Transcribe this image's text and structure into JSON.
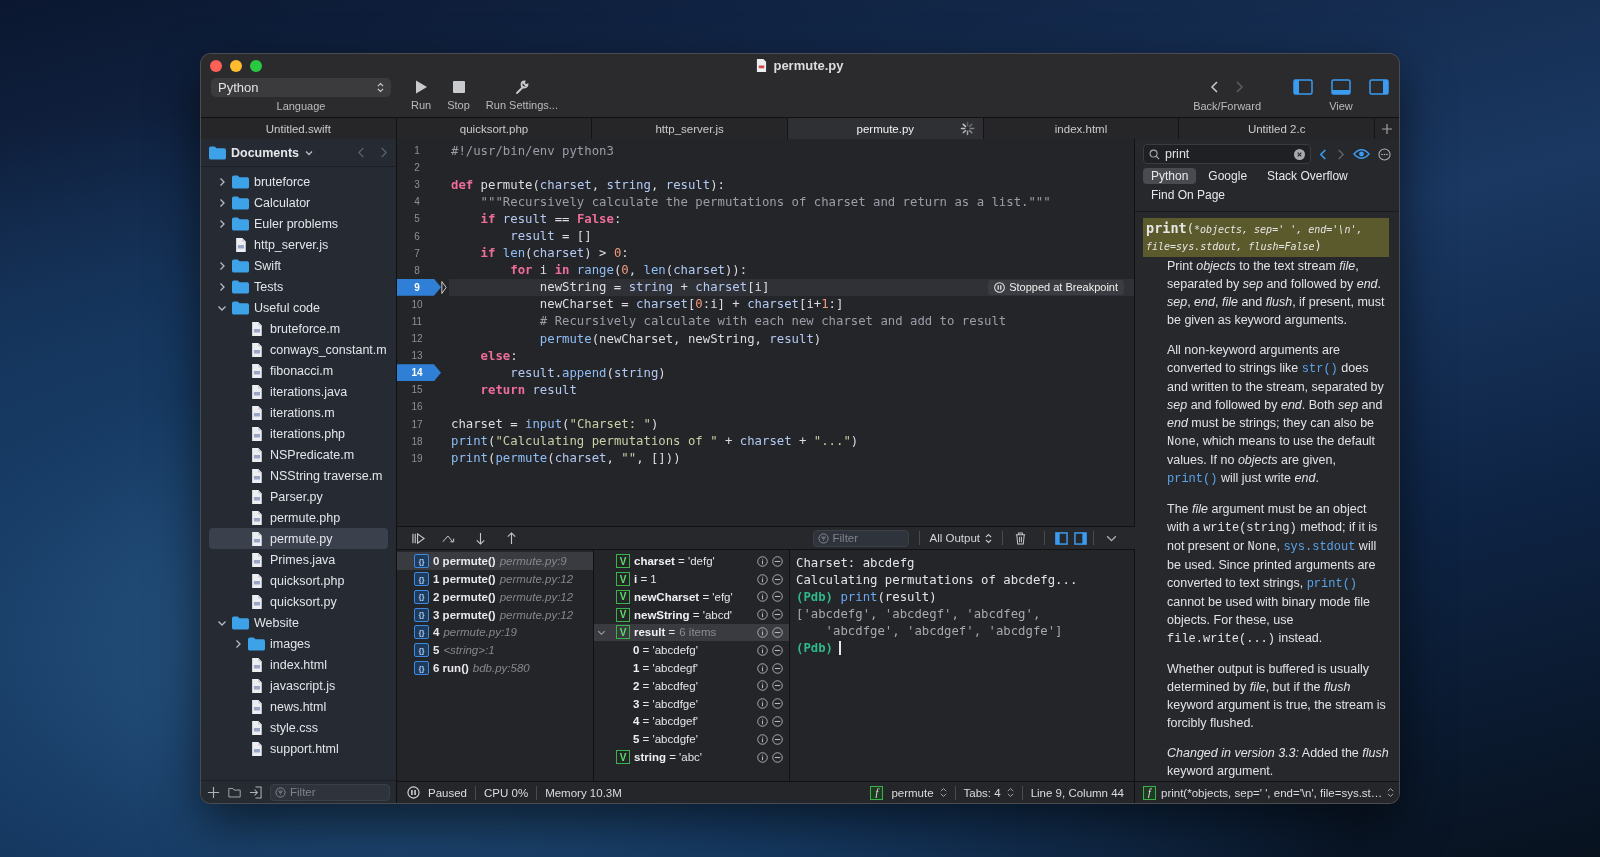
{
  "window": {
    "title": "permute.py"
  },
  "toolbar": {
    "language": {
      "value": "Python",
      "label": "Language"
    },
    "actions": [
      {
        "kind": "run",
        "label": "Run"
      },
      {
        "kind": "stop",
        "label": "Stop"
      },
      {
        "kind": "settings",
        "label": "Run Settings..."
      }
    ],
    "navigation": {
      "label": "Back/Forward",
      "back_enabled": true,
      "forward_enabled": false
    },
    "view": {
      "label": "View",
      "panels": [
        {
          "kind": "left",
          "on": true
        },
        {
          "kind": "bottom",
          "on": true
        },
        {
          "kind": "right",
          "on": true
        }
      ]
    }
  },
  "tabs": [
    {
      "label": "Untitled.swift",
      "selected": false,
      "busy": false
    },
    {
      "label": "quicksort.php",
      "selected": false,
      "busy": false
    },
    {
      "label": "http_server.js",
      "selected": false,
      "busy": false
    },
    {
      "label": "permute.py",
      "selected": true,
      "busy": true
    },
    {
      "label": "index.html",
      "selected": false,
      "busy": false
    },
    {
      "label": "Untitled 2.c",
      "selected": false,
      "busy": false
    }
  ],
  "sidebar": {
    "location": "Documents",
    "filter_placeholder": "Filter",
    "tools": [
      {
        "kind": "add"
      },
      {
        "kind": "folder"
      },
      {
        "kind": "import"
      }
    ],
    "items": [
      {
        "label": "bruteforce",
        "kind": "folder",
        "expanded": false,
        "selected": false
      },
      {
        "label": "Calculator",
        "kind": "folder",
        "expanded": false,
        "selected": false
      },
      {
        "label": "Euler problems",
        "kind": "folder",
        "expanded": false,
        "selected": false
      },
      {
        "label": "http_server.js",
        "kind": "file",
        "selected": false
      },
      {
        "label": "Swift",
        "kind": "folder",
        "expanded": false,
        "selected": false
      },
      {
        "label": "Tests",
        "kind": "folder",
        "expanded": false,
        "selected": false
      },
      {
        "label": "Useful code",
        "kind": "folder",
        "expanded": true,
        "selected": false,
        "children": [
          {
            "label": "bruteforce.m",
            "kind": "file",
            "selected": false
          },
          {
            "label": "conways_constant.m",
            "kind": "file",
            "selected": false
          },
          {
            "label": "fibonacci.m",
            "kind": "file",
            "selected": false
          },
          {
            "label": "iterations.java",
            "kind": "file",
            "selected": false
          },
          {
            "label": "iterations.m",
            "kind": "file",
            "selected": false
          },
          {
            "label": "iterations.php",
            "kind": "file",
            "selected": false
          },
          {
            "label": "NSPredicate.m",
            "kind": "file",
            "selected": false
          },
          {
            "label": "NSString traverse.m",
            "kind": "file",
            "selected": false
          },
          {
            "label": "Parser.py",
            "kind": "file",
            "selected": false
          },
          {
            "label": "permute.php",
            "kind": "file",
            "selected": false
          },
          {
            "label": "permute.py",
            "kind": "file",
            "selected": true
          },
          {
            "label": "Primes.java",
            "kind": "file",
            "selected": false
          },
          {
            "label": "quicksort.php",
            "kind": "file",
            "selected": false
          },
          {
            "label": "quicksort.py",
            "kind": "file",
            "selected": false
          }
        ]
      },
      {
        "label": "Website",
        "kind": "folder",
        "expanded": true,
        "selected": false,
        "children": [
          {
            "label": "images",
            "kind": "folder",
            "expanded": false,
            "selected": false
          },
          {
            "label": "index.html",
            "kind": "file",
            "selected": false
          },
          {
            "label": "javascript.js",
            "kind": "file",
            "selected": false
          },
          {
            "label": "news.html",
            "kind": "file",
            "selected": false
          },
          {
            "label": "style.css",
            "kind": "file",
            "selected": false
          },
          {
            "label": "support.html",
            "kind": "file",
            "selected": false
          }
        ]
      }
    ]
  },
  "editor": {
    "lines": [
      {
        "number": "1",
        "breakpoint": false,
        "current": false,
        "tokens": [
          {
            "kind": "comment",
            "text": "#!/usr/bin/env python3"
          }
        ]
      },
      {
        "number": "2",
        "breakpoint": false,
        "current": false
      },
      {
        "number": "3",
        "breakpoint": false,
        "current": false,
        "tokens": [
          {
            "kind": "kw",
            "text": "def"
          },
          {
            "kind": "plain",
            "text": " permute("
          },
          {
            "kind": "var",
            "text": "charset"
          },
          {
            "kind": "plain",
            "text": ", "
          },
          {
            "kind": "var",
            "text": "string"
          },
          {
            "kind": "plain",
            "text": ", "
          },
          {
            "kind": "var",
            "text": "result"
          },
          {
            "kind": "plain",
            "text": "):"
          }
        ]
      },
      {
        "number": "4",
        "breakpoint": false,
        "current": false,
        "tokens": [
          {
            "kind": "comment",
            "text": "    \"\"\"Recursively calculate the permutations of charset and return as a list.\"\"\""
          }
        ]
      },
      {
        "number": "5",
        "breakpoint": false,
        "current": false,
        "tokens": [
          {
            "kind": "kw",
            "text": "    if"
          },
          {
            "kind": "var",
            "text": " result"
          },
          {
            "kind": "plain",
            "text": " == "
          },
          {
            "kind": "kw",
            "text": "False"
          },
          {
            "kind": "plain",
            "text": ":"
          }
        ]
      },
      {
        "number": "6",
        "breakpoint": false,
        "current": false,
        "tokens": [
          {
            "kind": "var",
            "text": "        result"
          },
          {
            "kind": "plain",
            "text": " = []"
          }
        ]
      },
      {
        "number": "7",
        "breakpoint": false,
        "current": false,
        "tokens": [
          {
            "kind": "kw",
            "text": "    if"
          },
          {
            "kind": "call",
            "text": " len"
          },
          {
            "kind": "plain",
            "text": "("
          },
          {
            "kind": "var",
            "text": "charset"
          },
          {
            "kind": "plain",
            "text": ") > "
          },
          {
            "kind": "num",
            "text": "0"
          },
          {
            "kind": "plain",
            "text": ":"
          }
        ]
      },
      {
        "number": "8",
        "breakpoint": false,
        "current": false,
        "tokens": [
          {
            "kind": "kw",
            "text": "        for"
          },
          {
            "kind": "plain",
            "text": " i "
          },
          {
            "kind": "kw",
            "text": "in"
          },
          {
            "kind": "call",
            "text": " range"
          },
          {
            "kind": "plain",
            "text": "("
          },
          {
            "kind": "num",
            "text": "0"
          },
          {
            "kind": "plain",
            "text": ", "
          },
          {
            "kind": "call",
            "text": "len"
          },
          {
            "kind": "plain",
            "text": "("
          },
          {
            "kind": "var",
            "text": "charset"
          },
          {
            "kind": "plain",
            "text": ")):"
          }
        ]
      },
      {
        "number": "9",
        "breakpoint": true,
        "current": true,
        "badge": "Stopped at Breakpoint",
        "tokens": [
          {
            "kind": "plain",
            "text": "            newString = "
          },
          {
            "kind": "var",
            "text": "string"
          },
          {
            "kind": "plain",
            "text": " + "
          },
          {
            "kind": "var",
            "text": "charset"
          },
          {
            "kind": "plain",
            "text": "[i]"
          }
        ]
      },
      {
        "number": "10",
        "breakpoint": false,
        "current": false,
        "tokens": [
          {
            "kind": "plain",
            "text": "            newCharset = "
          },
          {
            "kind": "var",
            "text": "charset"
          },
          {
            "kind": "plain",
            "text": "["
          },
          {
            "kind": "num",
            "text": "0"
          },
          {
            "kind": "plain",
            "text": ":i] + "
          },
          {
            "kind": "var",
            "text": "charset"
          },
          {
            "kind": "plain",
            "text": "[i+"
          },
          {
            "kind": "num",
            "text": "1"
          },
          {
            "kind": "plain",
            "text": ":]"
          }
        ]
      },
      {
        "number": "11",
        "breakpoint": false,
        "current": false,
        "tokens": [
          {
            "kind": "comment",
            "text": "            # Recursively calculate with each new charset and add to result"
          }
        ]
      },
      {
        "number": "12",
        "breakpoint": false,
        "current": false,
        "tokens": [
          {
            "kind": "call",
            "text": "            permute"
          },
          {
            "kind": "plain",
            "text": "(newCharset, newString, "
          },
          {
            "kind": "var",
            "text": "result"
          },
          {
            "kind": "plain",
            "text": ")"
          }
        ]
      },
      {
        "number": "13",
        "breakpoint": false,
        "current": false,
        "tokens": [
          {
            "kind": "kw",
            "text": "    else"
          },
          {
            "kind": "plain",
            "text": ":"
          }
        ]
      },
      {
        "number": "14",
        "breakpoint": true,
        "current": false,
        "tokens": [
          {
            "kind": "var",
            "text": "        result"
          },
          {
            "kind": "plain",
            "text": "."
          },
          {
            "kind": "call",
            "text": "append"
          },
          {
            "kind": "plain",
            "text": "("
          },
          {
            "kind": "var",
            "text": "string"
          },
          {
            "kind": "plain",
            "text": ")"
          }
        ]
      },
      {
        "number": "15",
        "breakpoint": false,
        "current": false,
        "tokens": [
          {
            "kind": "kw",
            "text": "    return"
          },
          {
            "kind": "var",
            "text": " result"
          }
        ]
      },
      {
        "number": "16",
        "breakpoint": false,
        "current": false
      },
      {
        "number": "17",
        "breakpoint": false,
        "current": false,
        "tokens": [
          {
            "kind": "plain",
            "text": "charset = "
          },
          {
            "kind": "call",
            "text": "input"
          },
          {
            "kind": "plain",
            "text": "("
          },
          {
            "kind": "str",
            "text": "\"Charset: \""
          },
          {
            "kind": "plain",
            "text": ")"
          }
        ]
      },
      {
        "number": "18",
        "breakpoint": false,
        "current": false,
        "tokens": [
          {
            "kind": "call",
            "text": "print"
          },
          {
            "kind": "plain",
            "text": "("
          },
          {
            "kind": "str",
            "text": "\"Calculating permutations of \""
          },
          {
            "kind": "plain",
            "text": " + "
          },
          {
            "kind": "var",
            "text": "charset"
          },
          {
            "kind": "plain",
            "text": " + "
          },
          {
            "kind": "str",
            "text": "\"...\""
          },
          {
            "kind": "plain",
            "text": ")"
          }
        ]
      },
      {
        "number": "19",
        "breakpoint": false,
        "current": false,
        "tokens": [
          {
            "kind": "call",
            "text": "print"
          },
          {
            "kind": "plain",
            "text": "("
          },
          {
            "kind": "call",
            "text": "permute"
          },
          {
            "kind": "plain",
            "text": "("
          },
          {
            "kind": "var",
            "text": "charset"
          },
          {
            "kind": "plain",
            "text": ", "
          },
          {
            "kind": "str",
            "text": "\"\""
          },
          {
            "kind": "plain",
            "text": ", []))"
          }
        ]
      }
    ]
  },
  "debugger": {
    "controls": [
      {
        "kind": "continue"
      },
      {
        "kind": "step-over"
      },
      {
        "kind": "step-into"
      },
      {
        "kind": "step-out"
      }
    ],
    "filter_placeholder": "Filter",
    "output_select": "All Output",
    "panes": [
      {
        "kind": "left",
        "on": true
      },
      {
        "kind": "right",
        "on": true
      }
    ],
    "frames": [
      {
        "badge": "{}",
        "index": "0",
        "function": "permute()",
        "location": "permute.py:9",
        "selected": true
      },
      {
        "badge": "{}",
        "index": "1",
        "function": "permute()",
        "location": "permute.py:12",
        "selected": false
      },
      {
        "badge": "{}",
        "index": "2",
        "function": "permute()",
        "location": "permute.py:12",
        "selected": false
      },
      {
        "badge": "{}",
        "index": "3",
        "function": "permute()",
        "location": "permute.py:12",
        "selected": false
      },
      {
        "badge": "{}",
        "index": "4",
        "location": "permute.py:19",
        "selected": false
      },
      {
        "badge": "{}",
        "index": "5",
        "location": "<string>:1",
        "selected": false
      },
      {
        "badge": "{}",
        "index": "6",
        "function": "run()",
        "location": "bdb.py:580",
        "selected": false
      }
    ],
    "variables": [
      {
        "badge": "V",
        "text": "**charset** = 'defg'",
        "selected": false
      },
      {
        "badge": "V",
        "text": "**i** = 1",
        "selected": false
      },
      {
        "badge": "V",
        "text": "**newCharset** = 'efg'",
        "selected": false
      },
      {
        "badge": "V",
        "text": "**newString** = 'abcd'",
        "selected": false
      },
      {
        "badge": "V",
        "text": "**result** =",
        "summary": "6 items",
        "selected": true,
        "expanded": true,
        "children": [
          {
            "text": "**0** = 'abcdefg'",
            "selected": false
          },
          {
            "text": "**1** = 'abcdegf'",
            "selected": false
          },
          {
            "text": "**2** = 'abcdfeg'",
            "selected": false
          },
          {
            "text": "**3** = 'abcdfge'",
            "selected": false
          },
          {
            "text": "**4** = 'abcdgef'",
            "selected": false
          },
          {
            "text": "**5** = 'abcdgfe'",
            "selected": false
          }
        ]
      },
      {
        "badge": "V",
        "text": "**string** = 'abc'",
        "selected": false
      }
    ],
    "console": [
      {
        "cursor": false,
        "tokens": [
          {
            "kind": "output",
            "text": "Charset: abcdefg"
          }
        ]
      },
      {
        "cursor": false,
        "tokens": [
          {
            "kind": "output",
            "text": "Calculating permutations of abcdefg..."
          }
        ]
      },
      {
        "cursor": false,
        "tokens": [
          {
            "kind": "prompt",
            "text": "(Pdb)"
          },
          {
            "kind": "call",
            "text": " print"
          },
          {
            "kind": "plain",
            "text": "(result)"
          }
        ]
      },
      {
        "cursor": false,
        "tokens": [
          {
            "kind": "result",
            "text": "['abcdefg', 'abcdegf', 'abcdfeg',"
          }
        ]
      },
      {
        "cursor": false,
        "tokens": [
          {
            "kind": "result",
            "text": "    'abcdfge', 'abcdgef', 'abcdgfe']"
          }
        ]
      },
      {
        "cursor": true,
        "tokens": [
          {
            "kind": "prompt",
            "text": "(Pdb)"
          }
        ]
      }
    ]
  },
  "status_bar": {
    "state": "Paused",
    "cpu": "CPU 0%",
    "memory": "Memory 10.3M",
    "function": {
      "badge": "f",
      "name": "permute"
    },
    "tabs": "Tabs: 4",
    "position": "Line 9, Column 44"
  },
  "documentation": {
    "search": {
      "value": "print"
    },
    "back_enabled": true,
    "forward_enabled": false,
    "preview_on": true,
    "sources": [
      {
        "label": "Python",
        "selected": true
      },
      {
        "label": "Google",
        "selected": false
      },
      {
        "label": "Stack Overflow",
        "selected": false
      },
      {
        "label": "Find On Page",
        "selected": false
      }
    ],
    "signature": [
      {
        "kind": "name",
        "text": "print"
      },
      {
        "kind": "plain",
        "text": "("
      },
      {
        "kind": "args",
        "text": "*objects, sep=' ', end='\\n', file=sys.stdout, flush=False"
      },
      {
        "kind": "plain",
        "text": ")"
      }
    ],
    "paragraphs": [
      [
        {
          "kind": "plain",
          "text": "Print "
        },
        {
          "kind": "i",
          "text": "objects"
        },
        {
          "kind": "plain",
          "text": " to the text stream "
        },
        {
          "kind": "i",
          "text": "file"
        },
        {
          "kind": "plain",
          "text": ", separated by "
        },
        {
          "kind": "i",
          "text": "sep"
        },
        {
          "kind": "plain",
          "text": " and followed by "
        },
        {
          "kind": "i",
          "text": "end"
        },
        {
          "kind": "plain",
          "text": ". "
        },
        {
          "kind": "i",
          "text": "sep"
        },
        {
          "kind": "plain",
          "text": ", "
        },
        {
          "kind": "i",
          "text": "end"
        },
        {
          "kind": "plain",
          "text": ", "
        },
        {
          "kind": "i",
          "text": "file"
        },
        {
          "kind": "plain",
          "text": " and "
        },
        {
          "kind": "i",
          "text": "flush"
        },
        {
          "kind": "plain",
          "text": ", if present, must be given as keyword arguments."
        }
      ],
      [
        {
          "kind": "plain",
          "text": "All non-keyword arguments are converted to strings like "
        },
        {
          "kind": "link",
          "text": "str()"
        },
        {
          "kind": "plain",
          "text": " does and written to the stream, separated by "
        },
        {
          "kind": "i",
          "text": "sep"
        },
        {
          "kind": "plain",
          "text": " and followed by "
        },
        {
          "kind": "i",
          "text": "end"
        },
        {
          "kind": "plain",
          "text": ". Both "
        },
        {
          "kind": "i",
          "text": "sep"
        },
        {
          "kind": "plain",
          "text": " and "
        },
        {
          "kind": "i",
          "text": "end"
        },
        {
          "kind": "plain",
          "text": " must be strings; they can also be "
        },
        {
          "kind": "code",
          "text": "None"
        },
        {
          "kind": "plain",
          "text": ", which means to use the default values. If no "
        },
        {
          "kind": "i",
          "text": "objects"
        },
        {
          "kind": "plain",
          "text": " are given, "
        },
        {
          "kind": "link",
          "text": "print()"
        },
        {
          "kind": "plain",
          "text": " will just write "
        },
        {
          "kind": "i",
          "text": "end"
        },
        {
          "kind": "plain",
          "text": "."
        }
      ],
      [
        {
          "kind": "plain",
          "text": "The "
        },
        {
          "kind": "i",
          "text": "file"
        },
        {
          "kind": "plain",
          "text": " argument must be an object with a "
        },
        {
          "kind": "code",
          "text": "write(string)"
        },
        {
          "kind": "plain",
          "text": " method; if it is not present or "
        },
        {
          "kind": "code",
          "text": "None"
        },
        {
          "kind": "plain",
          "text": ", "
        },
        {
          "kind": "link",
          "text": "sys.stdout"
        },
        {
          "kind": "plain",
          "text": " will be used. Since printed arguments are converted to text strings, "
        },
        {
          "kind": "link",
          "text": "print()"
        },
        {
          "kind": "plain",
          "text": " cannot be used with binary mode file objects. For these, use "
        },
        {
          "kind": "code",
          "text": "file.write(...)"
        },
        {
          "kind": "plain",
          "text": " instead."
        }
      ],
      [
        {
          "kind": "plain",
          "text": "Whether output is buffered is usually determined by "
        },
        {
          "kind": "i",
          "text": "file"
        },
        {
          "kind": "plain",
          "text": ", but if the "
        },
        {
          "kind": "i",
          "text": "flush"
        },
        {
          "kind": "plain",
          "text": " keyword argument is true, the stream is forcibly flushed."
        }
      ],
      [
        {
          "kind": "i",
          "text": "Changed in version 3.3:"
        },
        {
          "kind": "plain",
          "text": " Added the "
        },
        {
          "kind": "i",
          "text": "flush"
        },
        {
          "kind": "plain",
          "text": " keyword argument."
        }
      ]
    ],
    "footer": {
      "badge": "f",
      "text": "print(*objects, sep=' ', end='\\n', file=sys.st…"
    }
  }
}
